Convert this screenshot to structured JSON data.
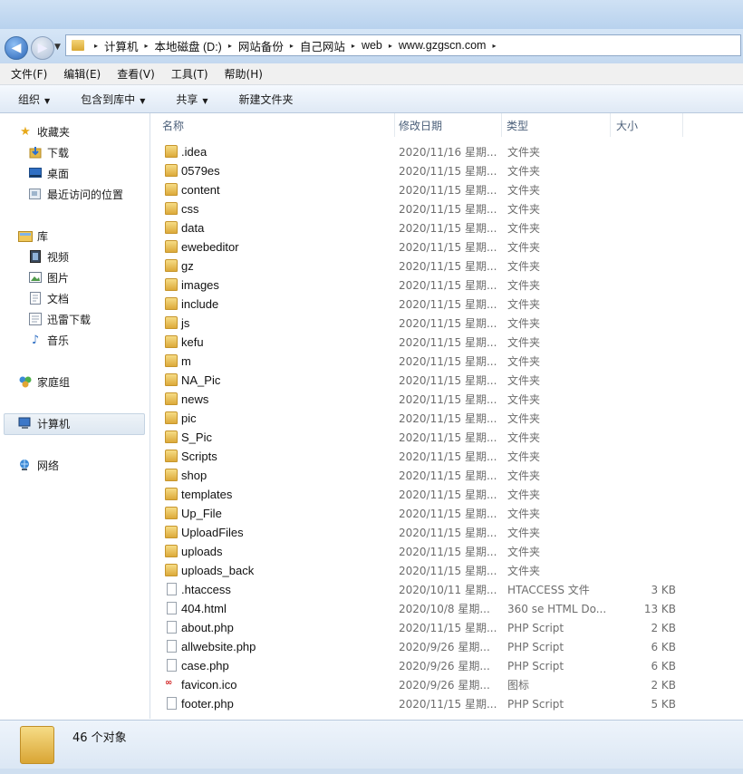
{
  "nav_buttons": {
    "back": "◀",
    "forward": "▶",
    "history": "▼"
  },
  "breadcrumb": [
    "计算机",
    "本地磁盘 (D:)",
    "网站备份",
    "自己网站",
    "web",
    "www.gzgscn.com"
  ],
  "breadcrumb_sep": "▸",
  "menu": [
    "文件(F)",
    "编辑(E)",
    "查看(V)",
    "工具(T)",
    "帮助(H)"
  ],
  "toolbar": {
    "organize": "组织",
    "include_in_library": "包含到库中",
    "share": "共享",
    "new_folder": "新建文件夹",
    "caret": "▼"
  },
  "sidebar": {
    "favorites": {
      "label": "收藏夹",
      "icon": "star-icon",
      "items": [
        {
          "label": "下载",
          "icon": "download-icon"
        },
        {
          "label": "桌面",
          "icon": "desktop-icon"
        },
        {
          "label": "最近访问的位置",
          "icon": "recent-places-icon"
        }
      ]
    },
    "libraries": {
      "label": "库",
      "icon": "library-icon",
      "items": [
        {
          "label": "视频",
          "icon": "video-icon"
        },
        {
          "label": "图片",
          "icon": "picture-icon"
        },
        {
          "label": "文档",
          "icon": "document-icon"
        },
        {
          "label": "迅雷下载",
          "icon": "thunder-download-icon"
        },
        {
          "label": "音乐",
          "icon": "music-icon"
        }
      ]
    },
    "homegroup": "家庭组",
    "computer": "计算机",
    "network": "网络"
  },
  "columns": {
    "name": "名称",
    "date": "修改日期",
    "type": "类型",
    "size": "大小",
    "sort_indicator": "^"
  },
  "files": [
    {
      "name": ".idea",
      "date": "2020/11/16 星期...",
      "type": "文件夹",
      "size": "",
      "kind": "folder"
    },
    {
      "name": "0579es",
      "date": "2020/11/15 星期...",
      "type": "文件夹",
      "size": "",
      "kind": "folder"
    },
    {
      "name": "content",
      "date": "2020/11/15 星期...",
      "type": "文件夹",
      "size": "",
      "kind": "folder"
    },
    {
      "name": "css",
      "date": "2020/11/15 星期...",
      "type": "文件夹",
      "size": "",
      "kind": "folder"
    },
    {
      "name": "data",
      "date": "2020/11/15 星期...",
      "type": "文件夹",
      "size": "",
      "kind": "folder"
    },
    {
      "name": "ewebeditor",
      "date": "2020/11/15 星期...",
      "type": "文件夹",
      "size": "",
      "kind": "folder"
    },
    {
      "name": "gz",
      "date": "2020/11/15 星期...",
      "type": "文件夹",
      "size": "",
      "kind": "folder"
    },
    {
      "name": "images",
      "date": "2020/11/15 星期...",
      "type": "文件夹",
      "size": "",
      "kind": "folder"
    },
    {
      "name": "include",
      "date": "2020/11/15 星期...",
      "type": "文件夹",
      "size": "",
      "kind": "folder"
    },
    {
      "name": "js",
      "date": "2020/11/15 星期...",
      "type": "文件夹",
      "size": "",
      "kind": "folder"
    },
    {
      "name": "kefu",
      "date": "2020/11/15 星期...",
      "type": "文件夹",
      "size": "",
      "kind": "folder"
    },
    {
      "name": "m",
      "date": "2020/11/15 星期...",
      "type": "文件夹",
      "size": "",
      "kind": "folder"
    },
    {
      "name": "NA_Pic",
      "date": "2020/11/15 星期...",
      "type": "文件夹",
      "size": "",
      "kind": "folder"
    },
    {
      "name": "news",
      "date": "2020/11/15 星期...",
      "type": "文件夹",
      "size": "",
      "kind": "folder"
    },
    {
      "name": "pic",
      "date": "2020/11/15 星期...",
      "type": "文件夹",
      "size": "",
      "kind": "folder"
    },
    {
      "name": "S_Pic",
      "date": "2020/11/15 星期...",
      "type": "文件夹",
      "size": "",
      "kind": "folder"
    },
    {
      "name": "Scripts",
      "date": "2020/11/15 星期...",
      "type": "文件夹",
      "size": "",
      "kind": "folder"
    },
    {
      "name": "shop",
      "date": "2020/11/15 星期...",
      "type": "文件夹",
      "size": "",
      "kind": "folder"
    },
    {
      "name": "templates",
      "date": "2020/11/15 星期...",
      "type": "文件夹",
      "size": "",
      "kind": "folder"
    },
    {
      "name": "Up_File",
      "date": "2020/11/15 星期...",
      "type": "文件夹",
      "size": "",
      "kind": "folder"
    },
    {
      "name": "UploadFiles",
      "date": "2020/11/15 星期...",
      "type": "文件夹",
      "size": "",
      "kind": "folder"
    },
    {
      "name": "uploads",
      "date": "2020/11/15 星期...",
      "type": "文件夹",
      "size": "",
      "kind": "folder"
    },
    {
      "name": "uploads_back",
      "date": "2020/11/15 星期...",
      "type": "文件夹",
      "size": "",
      "kind": "folder"
    },
    {
      "name": ".htaccess",
      "date": "2020/10/11 星期...",
      "type": "HTACCESS 文件",
      "size": "3 KB",
      "kind": "file"
    },
    {
      "name": "404.html",
      "date": "2020/10/8 星期...",
      "type": "360 se HTML Do...",
      "size": "13 KB",
      "kind": "file"
    },
    {
      "name": "about.php",
      "date": "2020/11/15 星期...",
      "type": "PHP Script",
      "size": "2 KB",
      "kind": "file"
    },
    {
      "name": "allwebsite.php",
      "date": "2020/9/26 星期...",
      "type": "PHP Script",
      "size": "6 KB",
      "kind": "file"
    },
    {
      "name": "case.php",
      "date": "2020/9/26 星期...",
      "type": "PHP Script",
      "size": "6 KB",
      "kind": "file"
    },
    {
      "name": "favicon.ico",
      "date": "2020/9/26 星期...",
      "type": "图标",
      "size": "2 KB",
      "kind": "icon"
    },
    {
      "name": "footer.php",
      "date": "2020/11/15 星期...",
      "type": "PHP Script",
      "size": "5 KB",
      "kind": "file"
    }
  ],
  "status": "46 个对象"
}
